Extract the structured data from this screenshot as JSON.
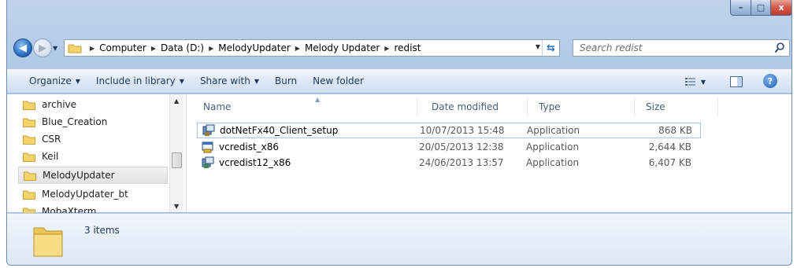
{
  "window": {
    "controls": {
      "minimize": "–",
      "maximize": "□",
      "close": "x"
    }
  },
  "address_bar": {
    "breadcrumbs": [
      "Computer",
      "Data (D:)",
      "MelodyUpdater",
      "Melody Updater",
      "redist"
    ]
  },
  "search": {
    "placeholder": "Search redist"
  },
  "toolbar": {
    "organize": "Organize",
    "include_in_library": "Include in library",
    "share_with": "Share with",
    "burn": "Burn",
    "new_folder": "New folder"
  },
  "nav_pane": {
    "items": [
      {
        "label": "archive"
      },
      {
        "label": "Blue_Creation"
      },
      {
        "label": "CSR"
      },
      {
        "label": "Keil"
      },
      {
        "label": "MelodyUpdater",
        "selected": true
      },
      {
        "label": "MelodyUpdater_bt"
      },
      {
        "label": "MobaXterm"
      }
    ]
  },
  "file_list": {
    "columns": {
      "name": "Name",
      "date": "Date modified",
      "type": "Type",
      "size": "Size"
    },
    "rows": [
      {
        "name": "dotNetFx40_Client_setup",
        "date": "10/07/2013 15:48",
        "type": "Application",
        "size": "868 KB"
      },
      {
        "name": "vcredist_x86",
        "date": "20/05/2013 12:38",
        "type": "Application",
        "size": "2,644 KB"
      },
      {
        "name": "vcredist12_x86",
        "date": "24/06/2013 13:57",
        "type": "Application",
        "size": "6,407 KB"
      }
    ]
  },
  "details_pane": {
    "item_count": "3 items"
  },
  "colors": {
    "accent": "#2a70c4",
    "close": "#c0392b",
    "folder": "#f5d36b"
  }
}
